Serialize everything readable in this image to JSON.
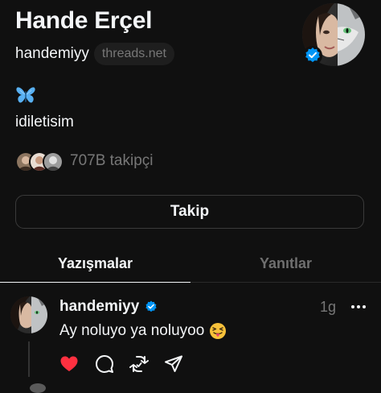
{
  "profile": {
    "display_name": "Hande Erçel",
    "handle": "handemiyy",
    "domain_badge": "threads.net",
    "bio_emoji": "butterfly-emoji",
    "bio_text": "idiletisim",
    "followers_text": "707B takipçi",
    "verified": true
  },
  "actions": {
    "follow_label": "Takip"
  },
  "tabs": [
    {
      "label": "Yazışmalar",
      "active": true
    },
    {
      "label": "Yanıtlar",
      "active": false
    }
  ],
  "post": {
    "author": "handemiyy",
    "time": "1g",
    "text": "Ay noluyo ya noluyoo",
    "text_emoji": "squinting-face-with-tongue-emoji",
    "liked": true,
    "icons": [
      "heart-icon",
      "comment-icon",
      "repost-icon",
      "share-icon",
      "more-icon"
    ]
  },
  "colors": {
    "background": "#101010",
    "text_primary": "#f3f5f7",
    "text_secondary": "#777777",
    "verified_blue": "#0095f6",
    "like_red": "#ff3040",
    "butterfly_blue": "#58b0f2"
  }
}
